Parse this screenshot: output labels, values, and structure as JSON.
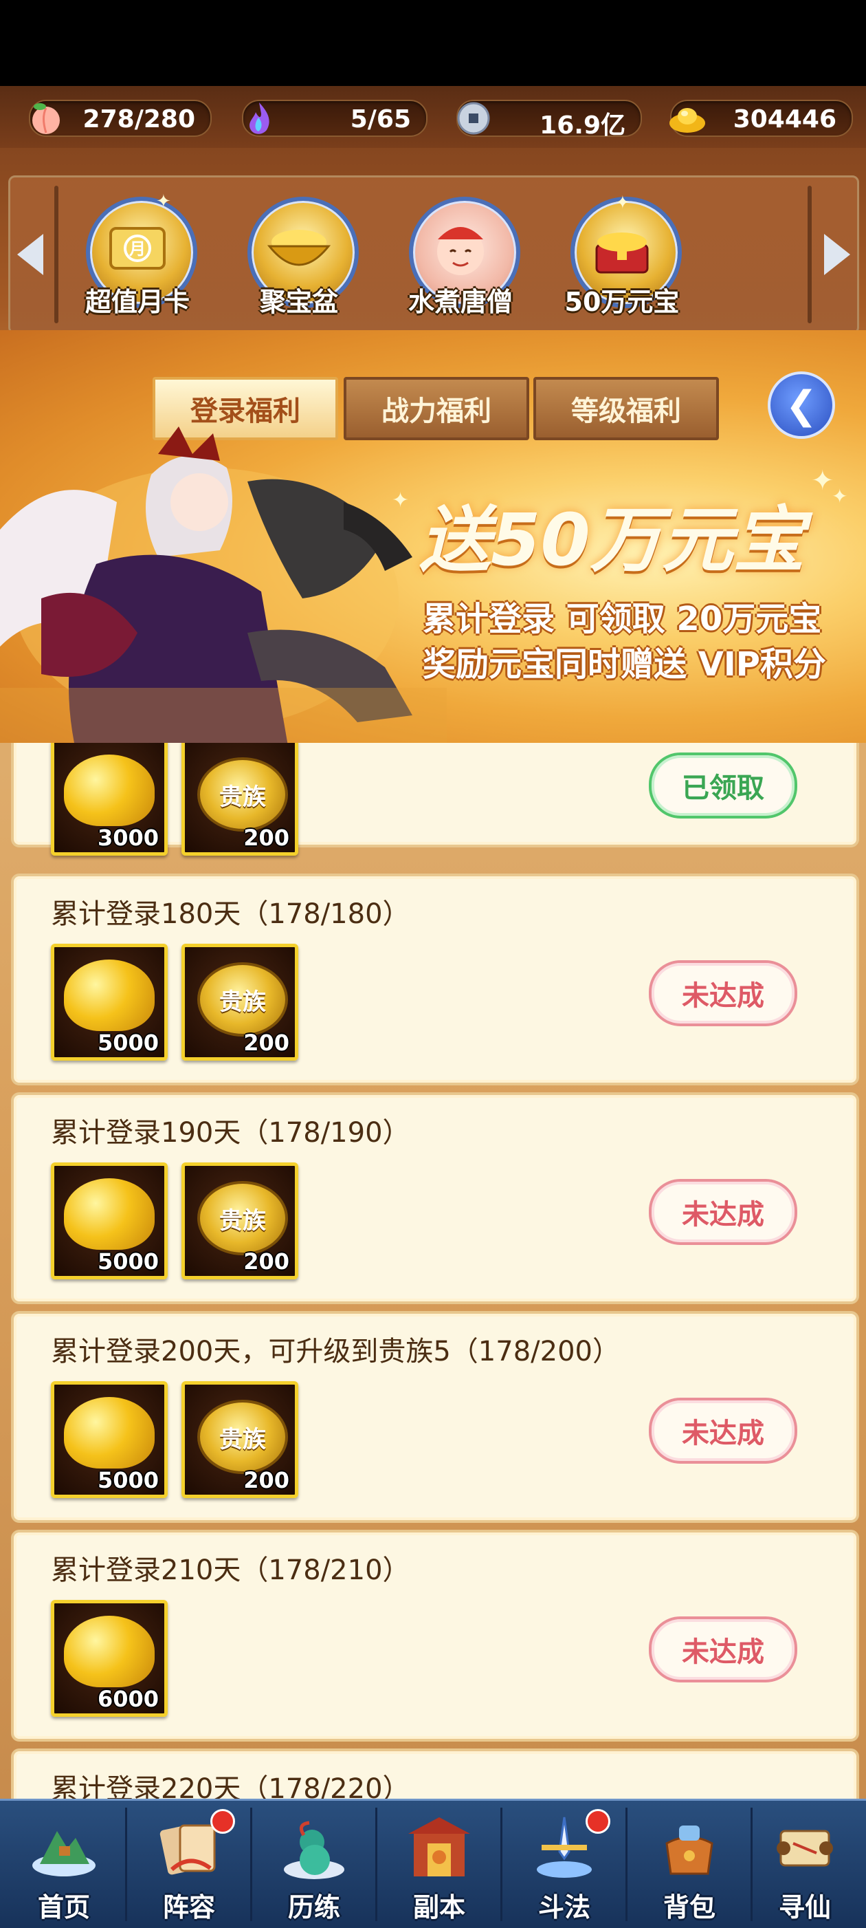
{
  "resources": [
    {
      "icon": "peach-icon",
      "value": "278/280"
    },
    {
      "icon": "spirit-flame-icon",
      "value": "5/65"
    },
    {
      "icon": "copper-coin-icon",
      "value": "16.9亿"
    },
    {
      "icon": "gold-ingot-icon",
      "value": "304446"
    }
  ],
  "activities": [
    {
      "label": "超值月卡",
      "icon": "month-card-icon"
    },
    {
      "label": "聚宝盆",
      "icon": "treasure-bowl-icon"
    },
    {
      "label": "水煮唐僧",
      "icon": "tang-monk-icon"
    },
    {
      "label": "50万元宝",
      "icon": "treasure-chest-icon"
    }
  ],
  "tabs": [
    {
      "label": "登录福利",
      "active": true
    },
    {
      "label": "战力福利",
      "active": false
    },
    {
      "label": "等级福利",
      "active": false
    }
  ],
  "banner": {
    "title": "送50万元宝",
    "line1": "累计登录 可领取 20万元宝",
    "line2": "奖励元宝同时赠送 VIP积分"
  },
  "rewards": [
    {
      "title": "",
      "items": [
        {
          "type": "ingot",
          "qty": "3000"
        },
        {
          "type": "noble",
          "label": "贵族",
          "qty": "200"
        }
      ],
      "status": "已领取",
      "claimed": true
    },
    {
      "title": "累计登录180天（178/180）",
      "items": [
        {
          "type": "ingot",
          "qty": "5000"
        },
        {
          "type": "noble",
          "label": "贵族",
          "qty": "200"
        }
      ],
      "status": "未达成",
      "claimed": false
    },
    {
      "title": "累计登录190天（178/190）",
      "items": [
        {
          "type": "ingot",
          "qty": "5000"
        },
        {
          "type": "noble",
          "label": "贵族",
          "qty": "200"
        }
      ],
      "status": "未达成",
      "claimed": false
    },
    {
      "title": "累计登录200天，可升级到贵族5（178/200）",
      "items": [
        {
          "type": "ingot",
          "qty": "5000"
        },
        {
          "type": "noble",
          "label": "贵族",
          "qty": "200"
        }
      ],
      "status": "未达成",
      "claimed": false
    },
    {
      "title": "累计登录210天（178/210）",
      "items": [
        {
          "type": "ingot",
          "qty": "6000"
        }
      ],
      "status": "未达成",
      "claimed": false
    },
    {
      "title": "累计登录220天（178/220）",
      "items": [],
      "status": "",
      "claimed": false
    }
  ],
  "nav": [
    {
      "label": "首页",
      "icon": "home-island-icon",
      "badge": false
    },
    {
      "label": "阵容",
      "icon": "lineup-cards-icon",
      "badge": true
    },
    {
      "label": "历练",
      "icon": "training-gourd-icon",
      "badge": false
    },
    {
      "label": "副本",
      "icon": "dungeon-gate-icon",
      "badge": false
    },
    {
      "label": "斗法",
      "icon": "battle-swords-icon",
      "badge": true
    },
    {
      "label": "背包",
      "icon": "backpack-icon",
      "badge": false
    },
    {
      "label": "寻仙",
      "icon": "scroll-map-icon",
      "badge": false
    }
  ],
  "colors": {
    "claimed": "#3aa653",
    "not_reached": "#de5a66",
    "tab_active": "#a34f1a",
    "nav_bg": "#17325a"
  }
}
